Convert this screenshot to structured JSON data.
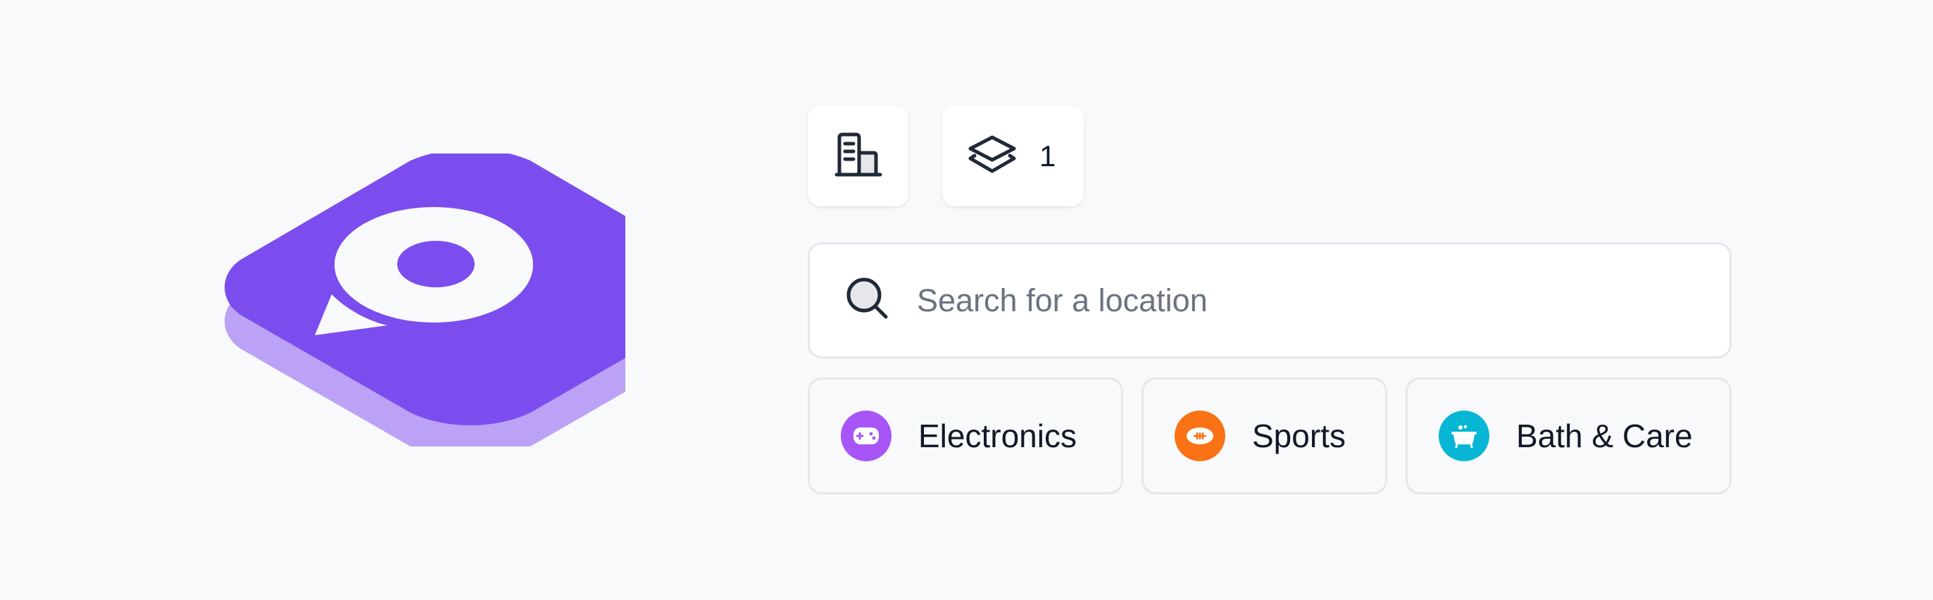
{
  "logo": {
    "name": "app-logo",
    "colors": {
      "top": "#7c4dee",
      "shadow": "#bba2f6",
      "mark": "#f8f9fa"
    }
  },
  "toolbar": {
    "building_button": {
      "icon": "building-icon"
    },
    "layers_button": {
      "icon": "layers-icon",
      "count": "1"
    }
  },
  "search": {
    "icon": "search-icon",
    "placeholder": "Search for a location",
    "value": ""
  },
  "categories": [
    {
      "label": "Electronics",
      "icon": "gamepad-icon",
      "color": "#a855f7"
    },
    {
      "label": "Sports",
      "icon": "football-icon",
      "color": "#f97316"
    },
    {
      "label": "Bath & Care",
      "icon": "bathtub-icon",
      "color": "#06b6d4"
    }
  ]
}
